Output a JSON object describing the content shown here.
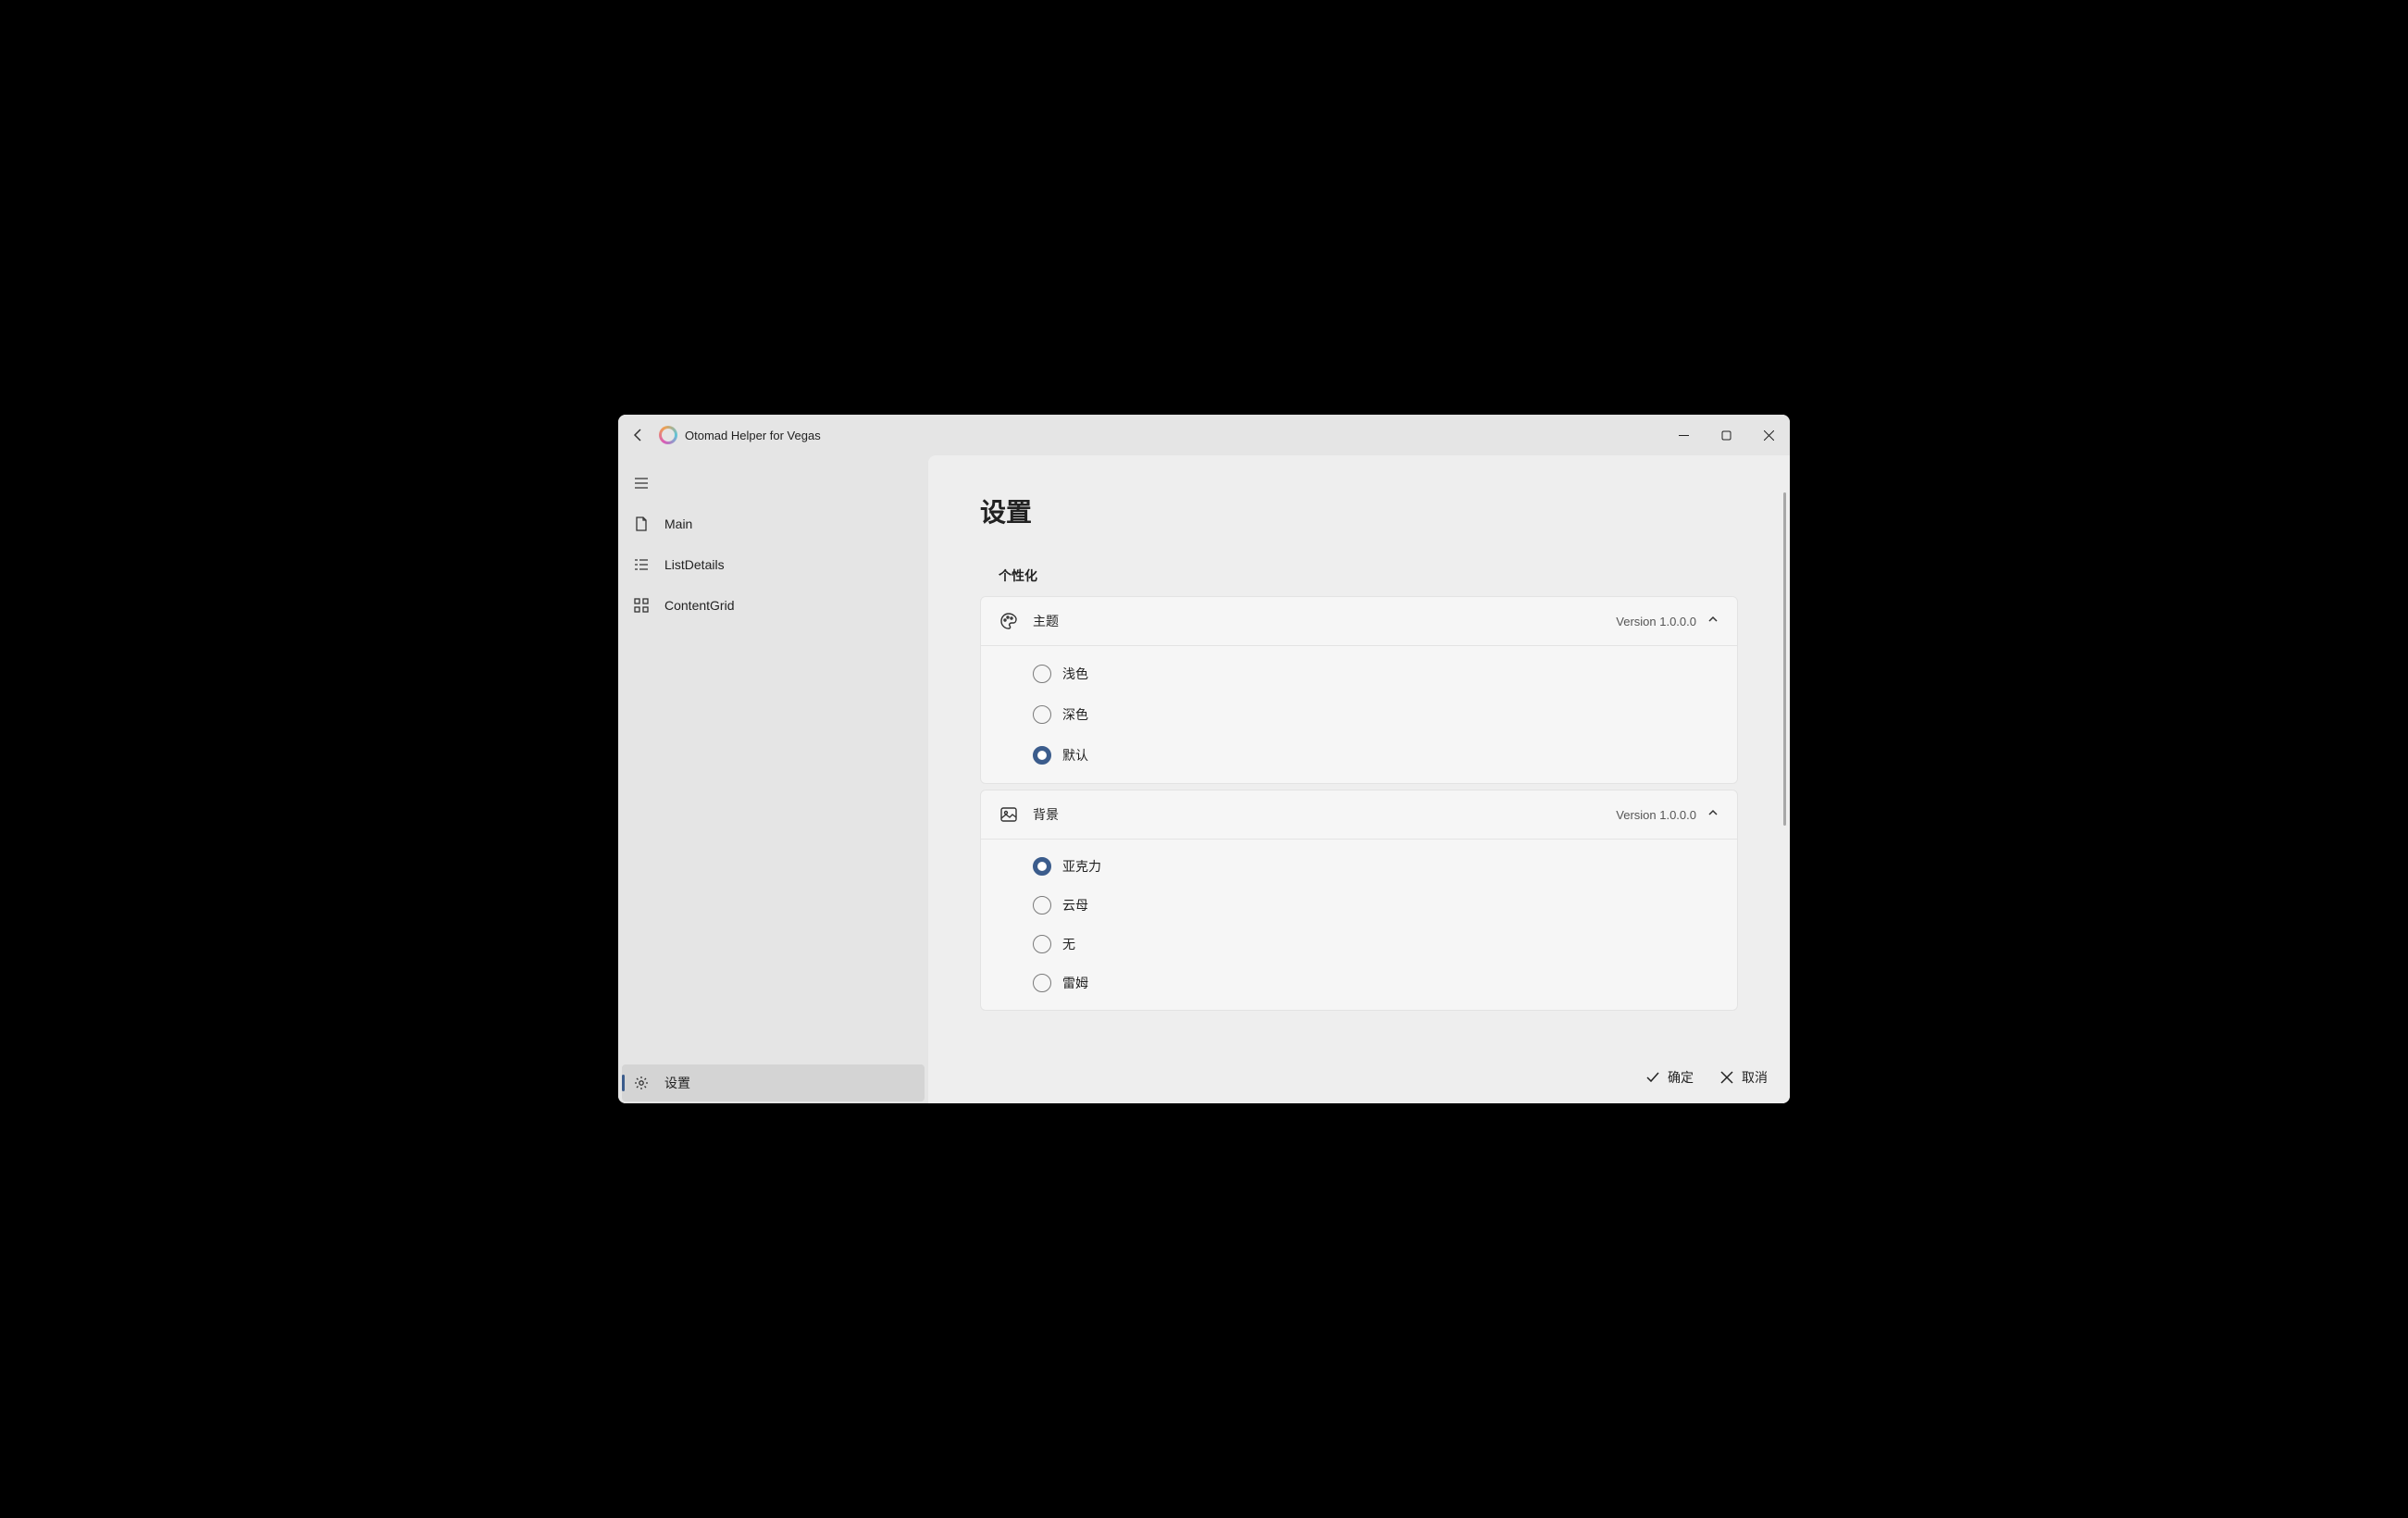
{
  "app": {
    "title": "Otomad Helper for Vegas"
  },
  "sidebar": {
    "items": [
      {
        "label": "Main"
      },
      {
        "label": "ListDetails"
      },
      {
        "label": "ContentGrid"
      }
    ],
    "settings_label": "设置"
  },
  "page": {
    "title": "设置",
    "section_personalization": "个性化",
    "theme": {
      "title": "主题",
      "meta": "Version 1.0.0.0",
      "options": [
        {
          "label": "浅色",
          "selected": false
        },
        {
          "label": "深色",
          "selected": false
        },
        {
          "label": "默认",
          "selected": true
        }
      ]
    },
    "background": {
      "title": "背景",
      "meta": "Version 1.0.0.0",
      "options": [
        {
          "label": "亚克力",
          "selected": true
        },
        {
          "label": "云母",
          "selected": false
        },
        {
          "label": "无",
          "selected": false
        },
        {
          "label": "雷姆",
          "selected": false
        }
      ]
    }
  },
  "footer": {
    "ok": "确定",
    "cancel": "取消"
  }
}
